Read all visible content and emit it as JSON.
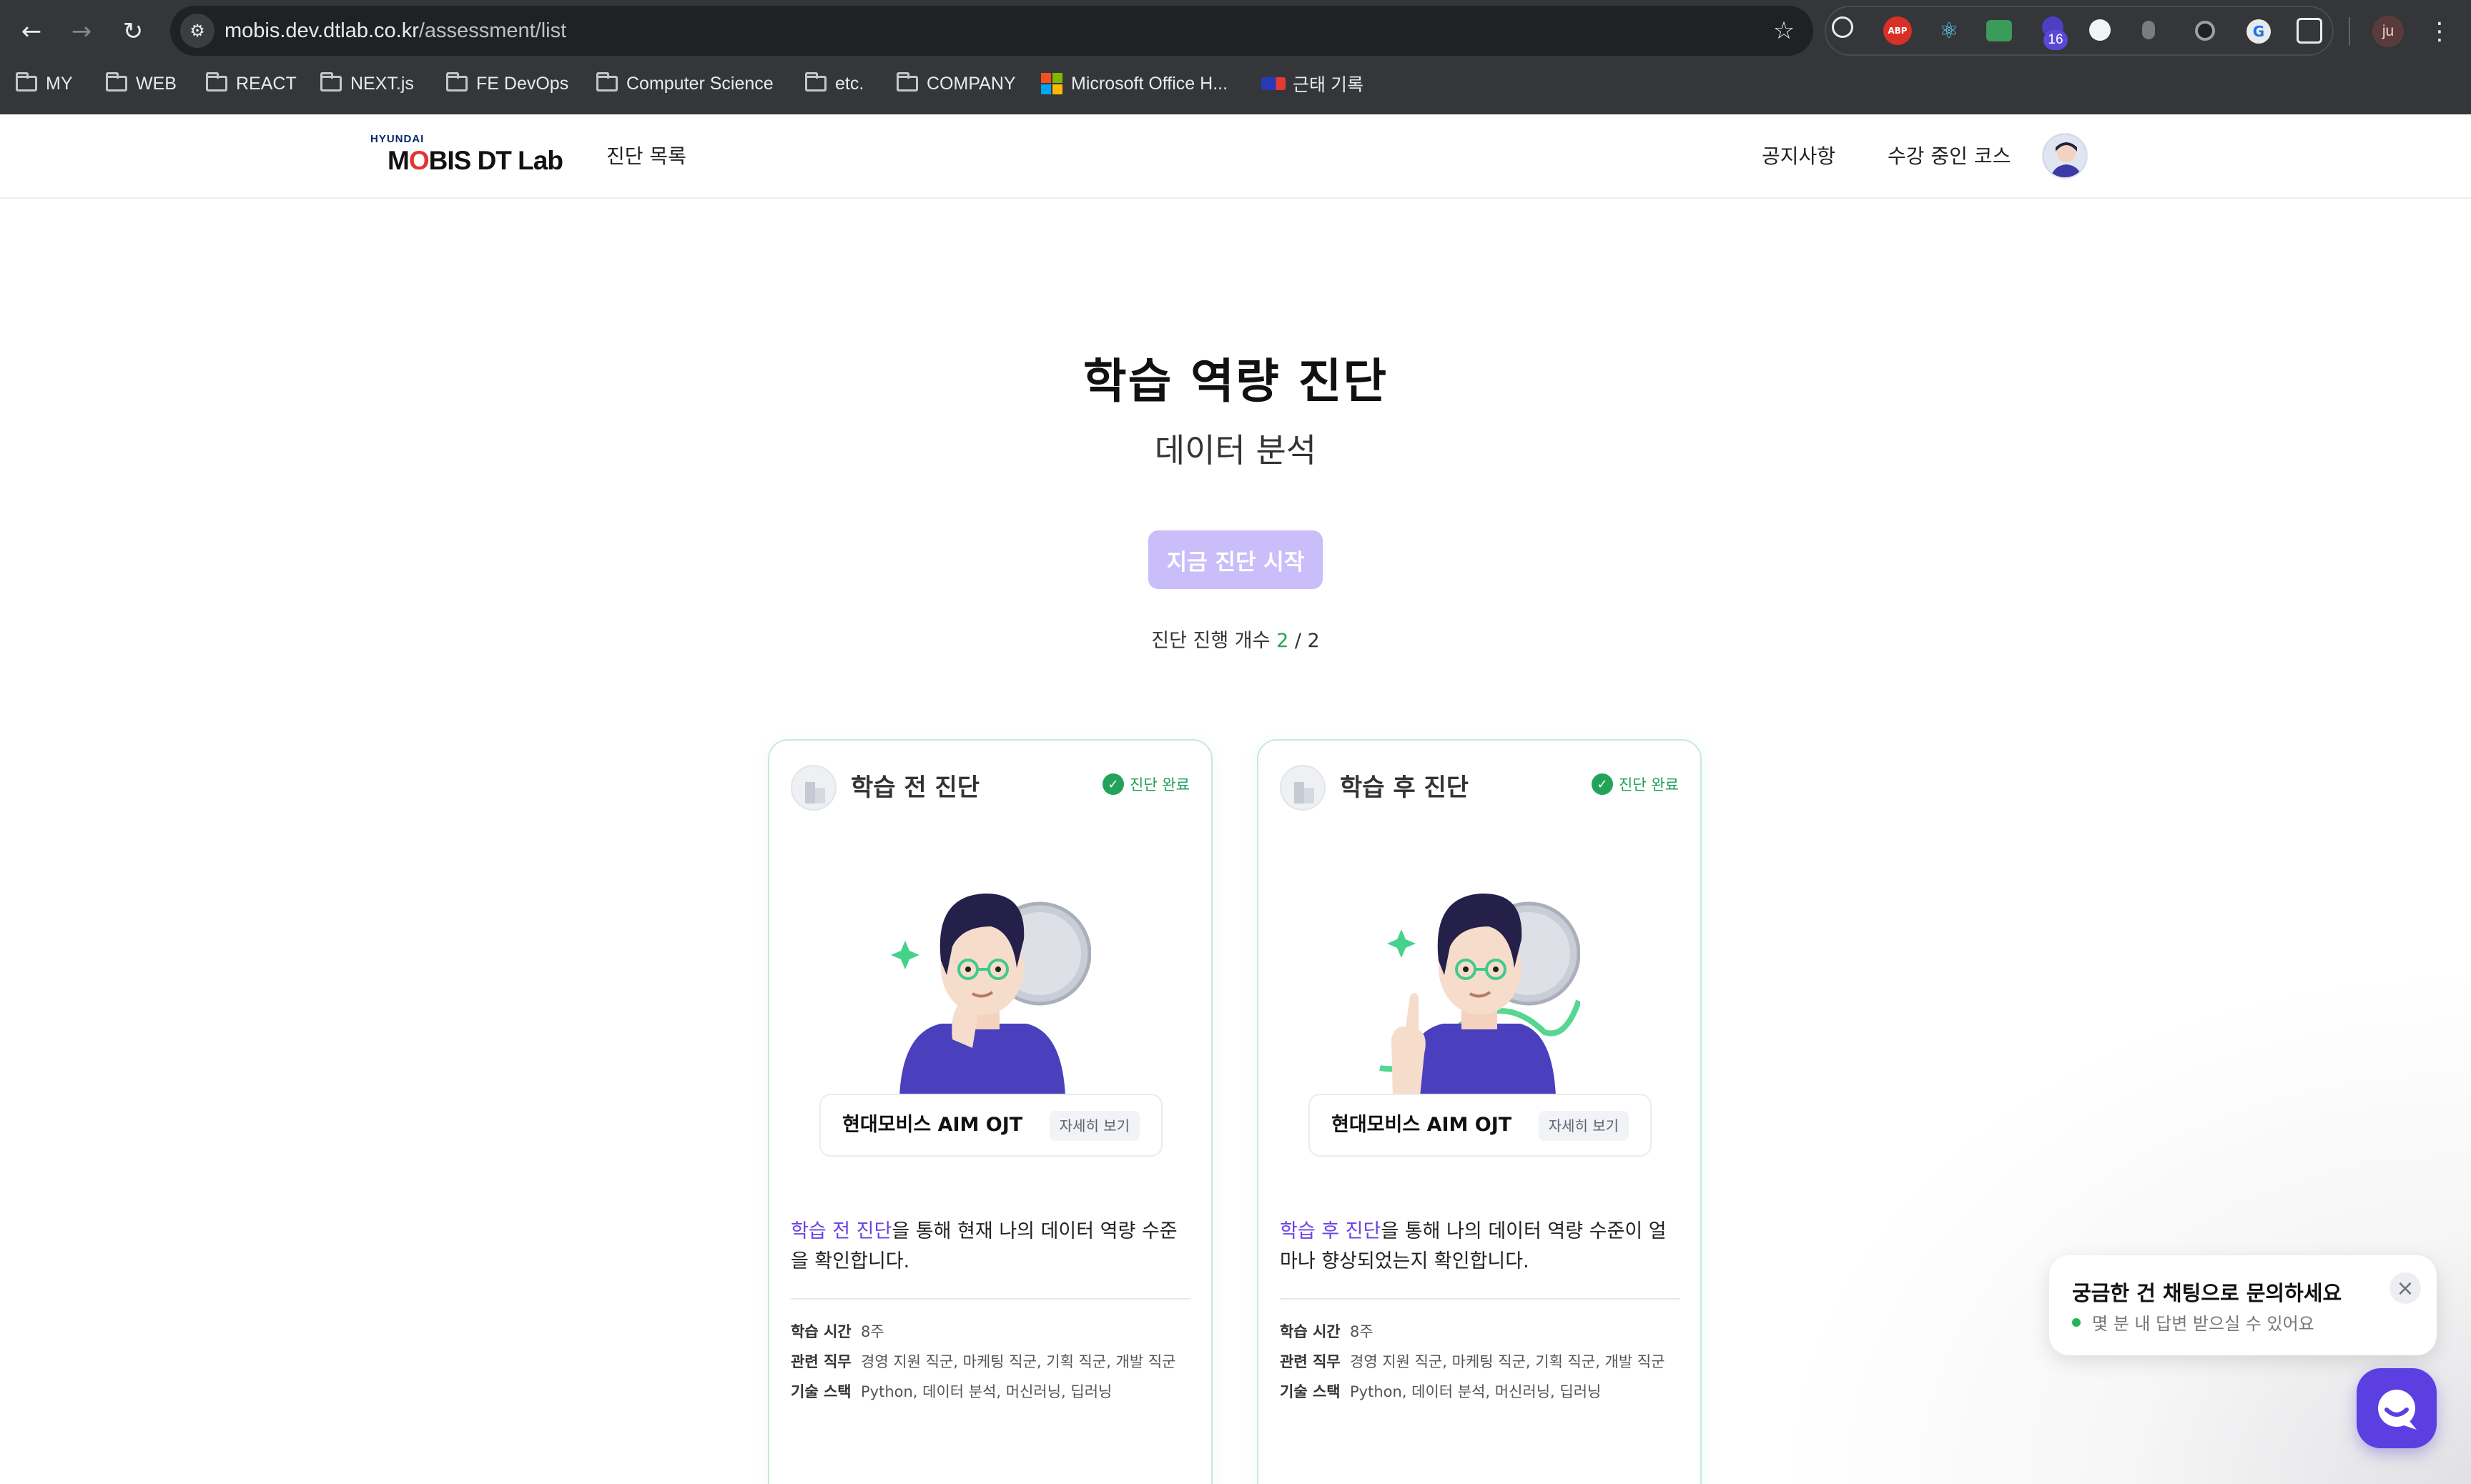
{
  "browser": {
    "url_host": "mobis.dev.dtlab.co.kr",
    "url_path": "/assessment/list",
    "extensions": [
      "timer-icon",
      "adblock-icon",
      "react-devtools-icon",
      "mail-icon",
      "extension-badge-icon",
      "extension-circle-icon",
      "extension-gray-icon",
      "extension-dark-icon",
      "extension-g-icon",
      "puzzle-icon"
    ],
    "ext_abp_label": "ABP",
    "ext_badge_count": "16",
    "profile_initials": "ju",
    "bookmarks": [
      {
        "label": "MY",
        "type": "folder"
      },
      {
        "label": "WEB",
        "type": "folder"
      },
      {
        "label": "REACT",
        "type": "folder"
      },
      {
        "label": "NEXT.js",
        "type": "folder"
      },
      {
        "label": "FE DevOps",
        "type": "folder"
      },
      {
        "label": "Computer Science",
        "type": "folder"
      },
      {
        "label": "etc.",
        "type": "folder"
      },
      {
        "label": "COMPANY",
        "type": "folder"
      },
      {
        "label": "Microsoft Office H...",
        "type": "link"
      },
      {
        "label": "근태 기록",
        "type": "link"
      }
    ]
  },
  "header": {
    "logo_small": "HYUNDAI",
    "logo_main_pre": "M",
    "logo_main_o": "O",
    "logo_main_post": "BIS DT Lab",
    "nav_left": "진단 목록",
    "nav_notice": "공지사항",
    "nav_courses": "수강 중인 코스"
  },
  "hero": {
    "title": "학습 역량 진단",
    "subtitle": "데이터 분석",
    "start_button": "지금 진단 시작",
    "progress_label": "진단 진행 개수",
    "progress_done": "2",
    "progress_sep": " / ",
    "progress_total": "2"
  },
  "cards": [
    {
      "title": "학습 전 진단",
      "status": "진단 완료",
      "course_name": "현대모비스 AIM OJT",
      "detail_button": "자세히 보기",
      "desc_highlight": "학습 전 진단",
      "desc_rest": "을 통해 현재 나의 데이터 역량 수준을 확인합니다.",
      "meta": [
        {
          "label": "학습 시간",
          "value": "8주"
        },
        {
          "label": "관련 직무",
          "value": "경영 지원 직군, 마케팅 직군, 기획 직군, 개발 직군"
        },
        {
          "label": "기술 스택",
          "value": "Python, 데이터 분석, 머신러닝, 딥러닝"
        }
      ]
    },
    {
      "title": "학습 후 진단",
      "status": "진단 완료",
      "course_name": "현대모비스 AIM OJT",
      "detail_button": "자세히 보기",
      "desc_highlight": "학습 후 진단",
      "desc_rest": "을 통해 나의 데이터 역량 수준이 얼마나 향상되었는지 확인합니다.",
      "meta": [
        {
          "label": "학습 시간",
          "value": "8주"
        },
        {
          "label": "관련 직무",
          "value": "경영 지원 직군, 마케팅 직군, 기획 직군, 개발 직군"
        },
        {
          "label": "기술 스택",
          "value": "Python, 데이터 분석, 머신러닝, 딥러닝"
        }
      ]
    }
  ],
  "chat": {
    "title": "궁금한 건 채팅으로 문의하세요",
    "subtitle": "몇 분 내 답변 받으실 수 있어요"
  },
  "colors": {
    "accent_purple": "#6a42e8",
    "start_button_disabled": "#c9bdfa",
    "status_green": "#23a35a",
    "card_border": "#c5ecd2",
    "chat_button": "#5b3fe0"
  }
}
